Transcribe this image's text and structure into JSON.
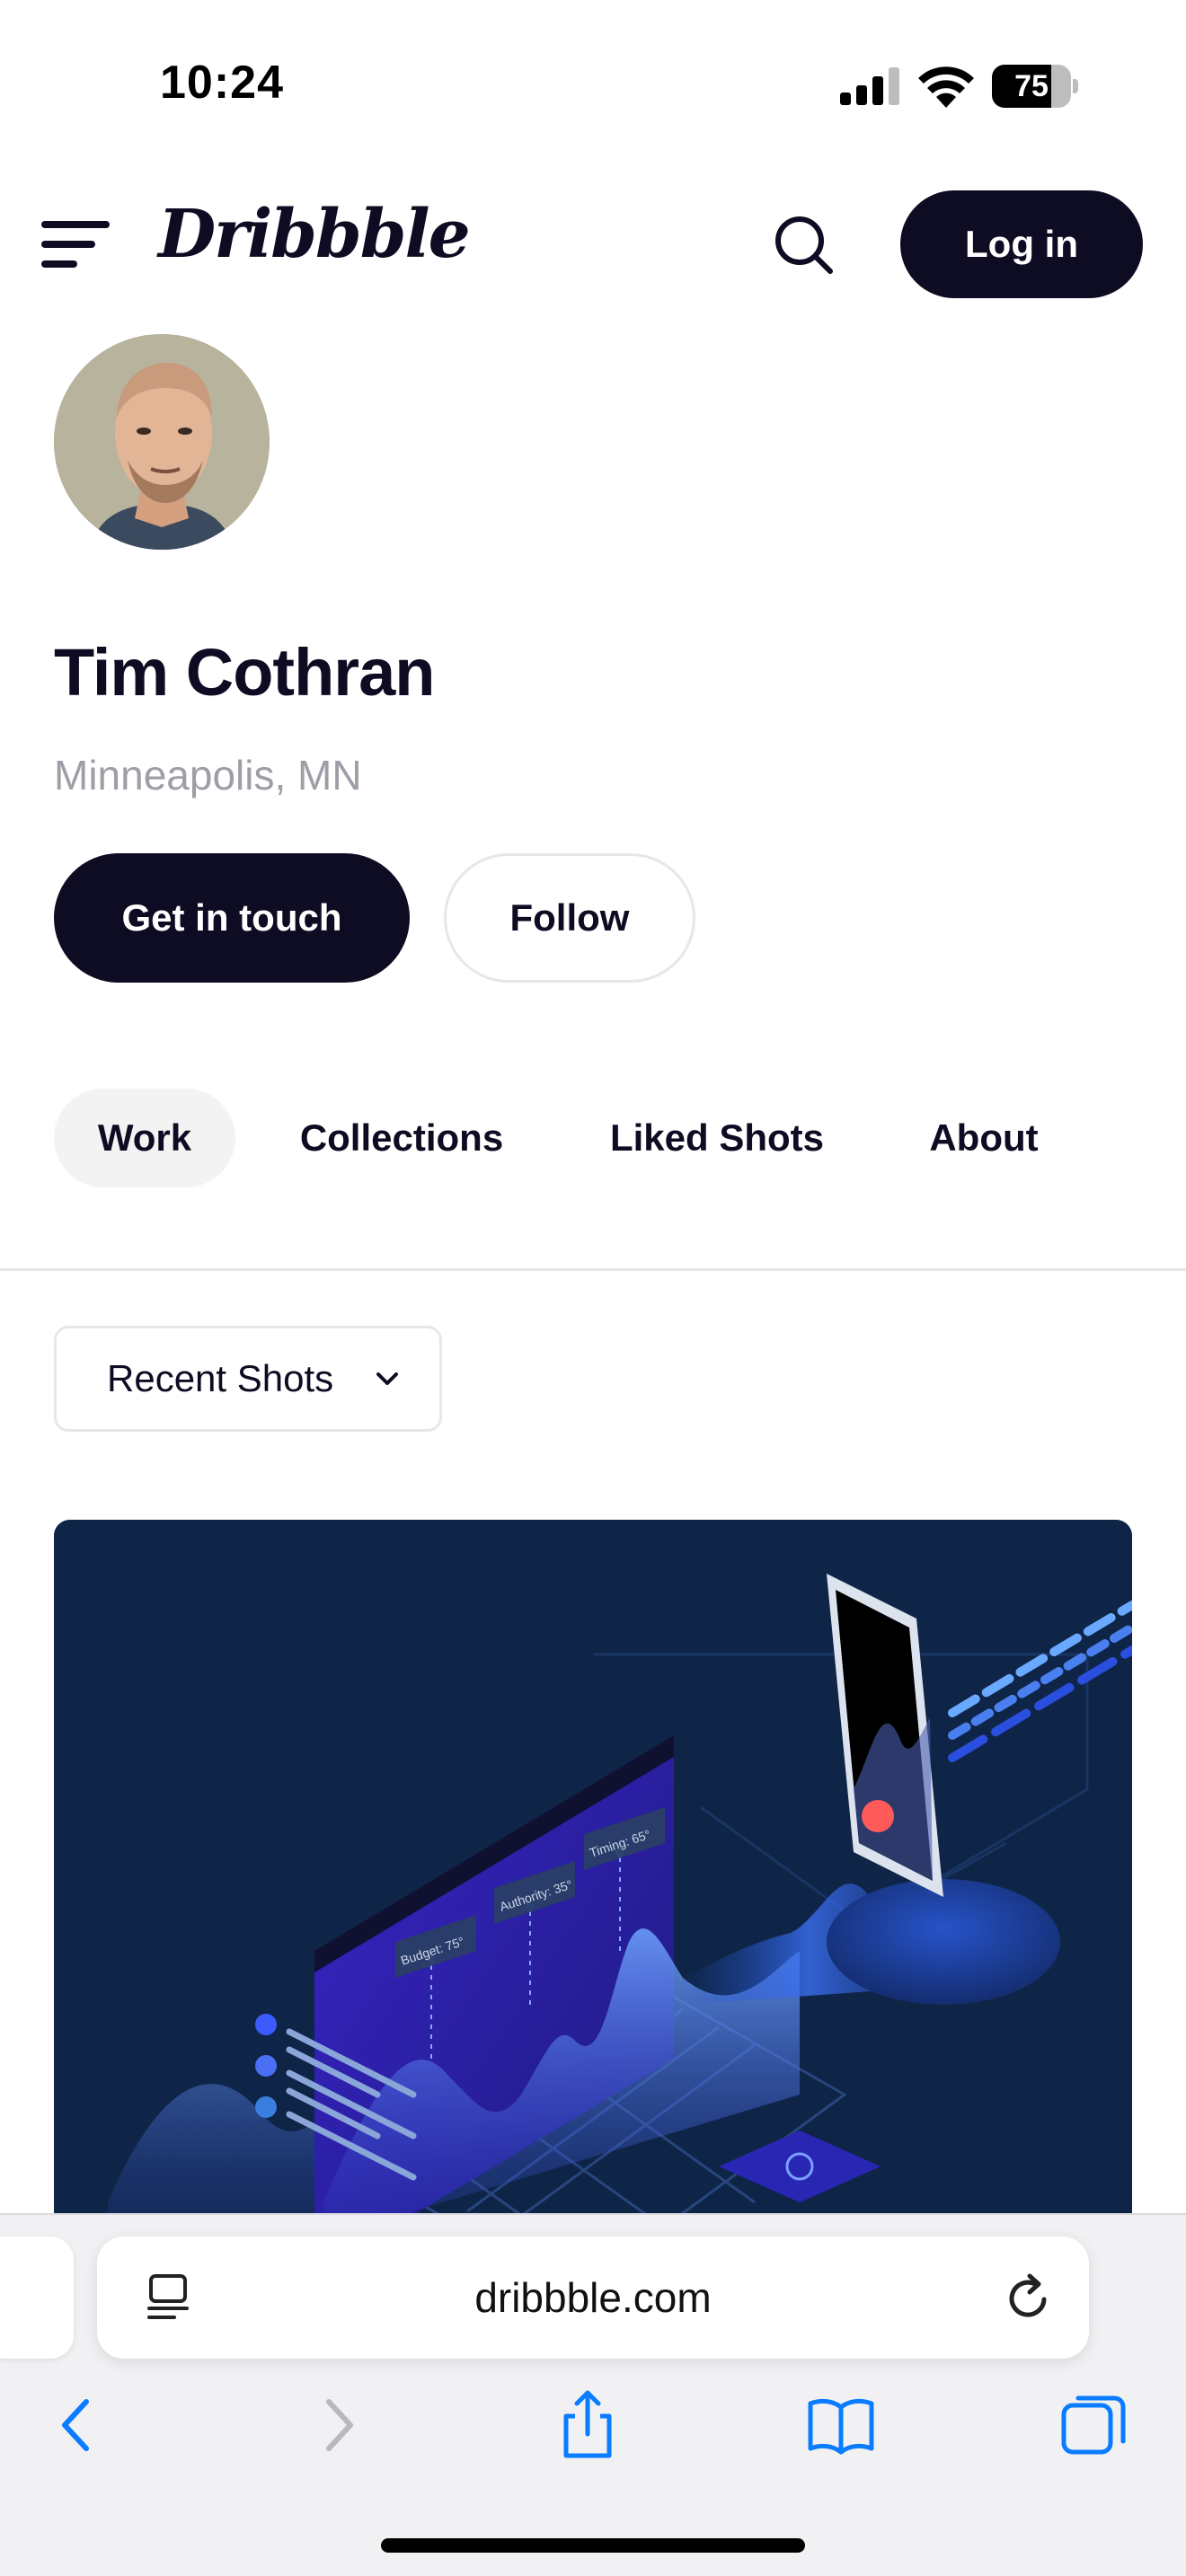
{
  "status_bar": {
    "time": "10:24",
    "battery_level": "75",
    "battery_fraction": 0.75,
    "icons": [
      "cellular-signal-icon",
      "wifi-icon",
      "battery-icon"
    ]
  },
  "header": {
    "menu_icon": "hamburger-menu-icon",
    "logo": "Dribbble",
    "search_icon": "search-icon",
    "login_label": "Log in"
  },
  "profile": {
    "name": "Tim Cothran",
    "location": "Minneapolis, MN",
    "contact_label": "Get in touch",
    "follow_label": "Follow"
  },
  "tabs": [
    {
      "label": "Work",
      "active": true
    },
    {
      "label": "Collections",
      "active": false
    },
    {
      "label": "Liked Shots",
      "active": false
    },
    {
      "label": "About",
      "active": false
    }
  ],
  "filter": {
    "selected": "Recent Shots",
    "icon": "chevron-down-icon"
  },
  "shot": {
    "labels": [
      "Budget: 75°",
      "Authority: 35°",
      "Timing: 65°"
    ],
    "colors": {
      "background": "#0f2547",
      "accent": "#3b5bff",
      "screen": "#2b1fa8"
    }
  },
  "browser": {
    "url": "dribbble.com",
    "icons": [
      "reader-icon",
      "reload-icon",
      "back-icon",
      "forward-icon",
      "share-icon",
      "bookmarks-icon",
      "tabs-icon"
    ]
  },
  "colors": {
    "primary": "#0d0c22",
    "muted_text": "#9e9ea7",
    "border": "#e7e7e9",
    "ios_blue": "#0a7cff"
  }
}
